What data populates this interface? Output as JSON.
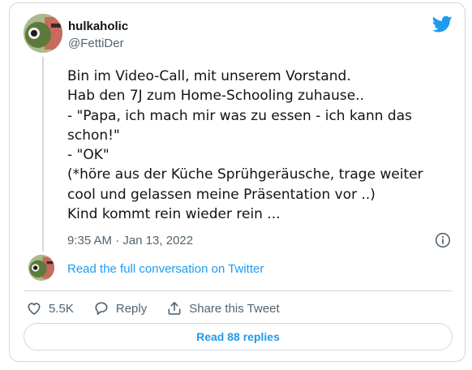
{
  "user": {
    "display_name": "hulkaholic",
    "handle": "@FettiDer"
  },
  "tweet": {
    "text": "Bin im Video-Call, mit unserem Vorstand.\nHab den 7J zum Home-Schooling zuhause..\n- \"Papa, ich mach mir was zu essen - ich kann das schon!\"\n- \"OK\"\n(*höre aus der Küche Sprühgeräusche, trage weiter cool und gelassen meine Präsentation vor ..)\nKind kommt rein wieder rein ...",
    "timestamp": "9:35 AM · Jan 13, 2022"
  },
  "conversation": {
    "link_label": "Read the full conversation on Twitter"
  },
  "actions": {
    "like_count": "5.5K",
    "reply_label": "Reply",
    "share_label": "Share this Tweet"
  },
  "footer": {
    "read_replies_label": "Read 88 replies"
  },
  "colors": {
    "brand": "#1d9bf0",
    "text": "#0f1419",
    "muted": "#536471",
    "border": "#cfd9de"
  },
  "icons": [
    "twitter-bird-icon",
    "info-icon",
    "heart-icon",
    "reply-icon",
    "share-icon"
  ]
}
